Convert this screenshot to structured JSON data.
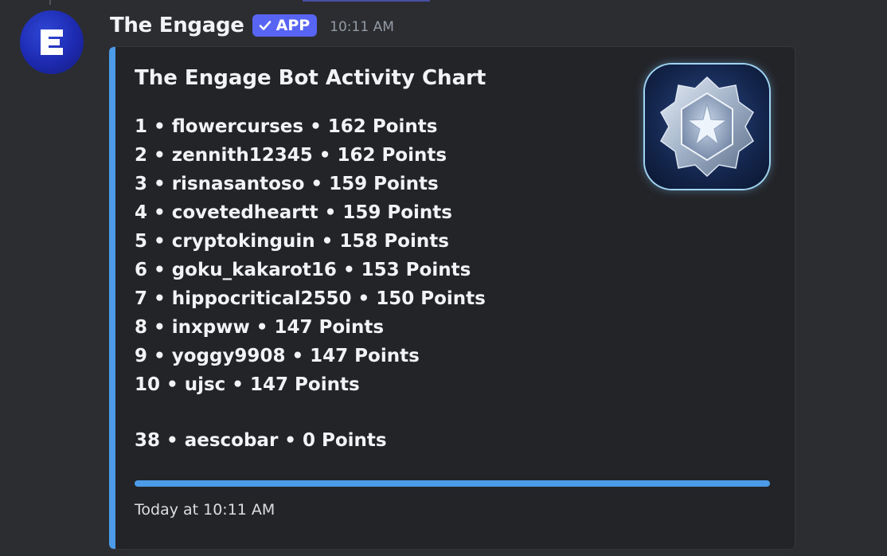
{
  "message": {
    "author": "The Engage",
    "app_tag": "APP",
    "timestamp": "10:11 AM",
    "avatar_icon": "engage-e-logo-icon",
    "colors": {
      "background": "#2b2d31",
      "embed_background": "#232428",
      "embed_accent": "#4c9be8",
      "app_tag": "#5865f2"
    }
  },
  "embed": {
    "title": "The Engage Bot Activity Chart",
    "thumbnail_icon": "silver-star-badge-icon",
    "entries": [
      "1 • flowercurses • 162 Points",
      "2 • zennith12345 • 162 Points",
      "3 • risnasantoso • 159 Points",
      "4 • covetedheartt • 159 Points",
      "5 • cryptokinguin • 158 Points",
      "6 • goku_kakarot16 • 153 Points",
      "7 • hippocritical2550 • 150 Points",
      "8 • inxpww • 147 Points",
      "9 • yoggy9908 • 147 Points",
      "10 • ujsc • 147 Points"
    ],
    "self_entry": "38 • aescobar • 0 Points",
    "footer": "Today at 10:11 AM"
  }
}
